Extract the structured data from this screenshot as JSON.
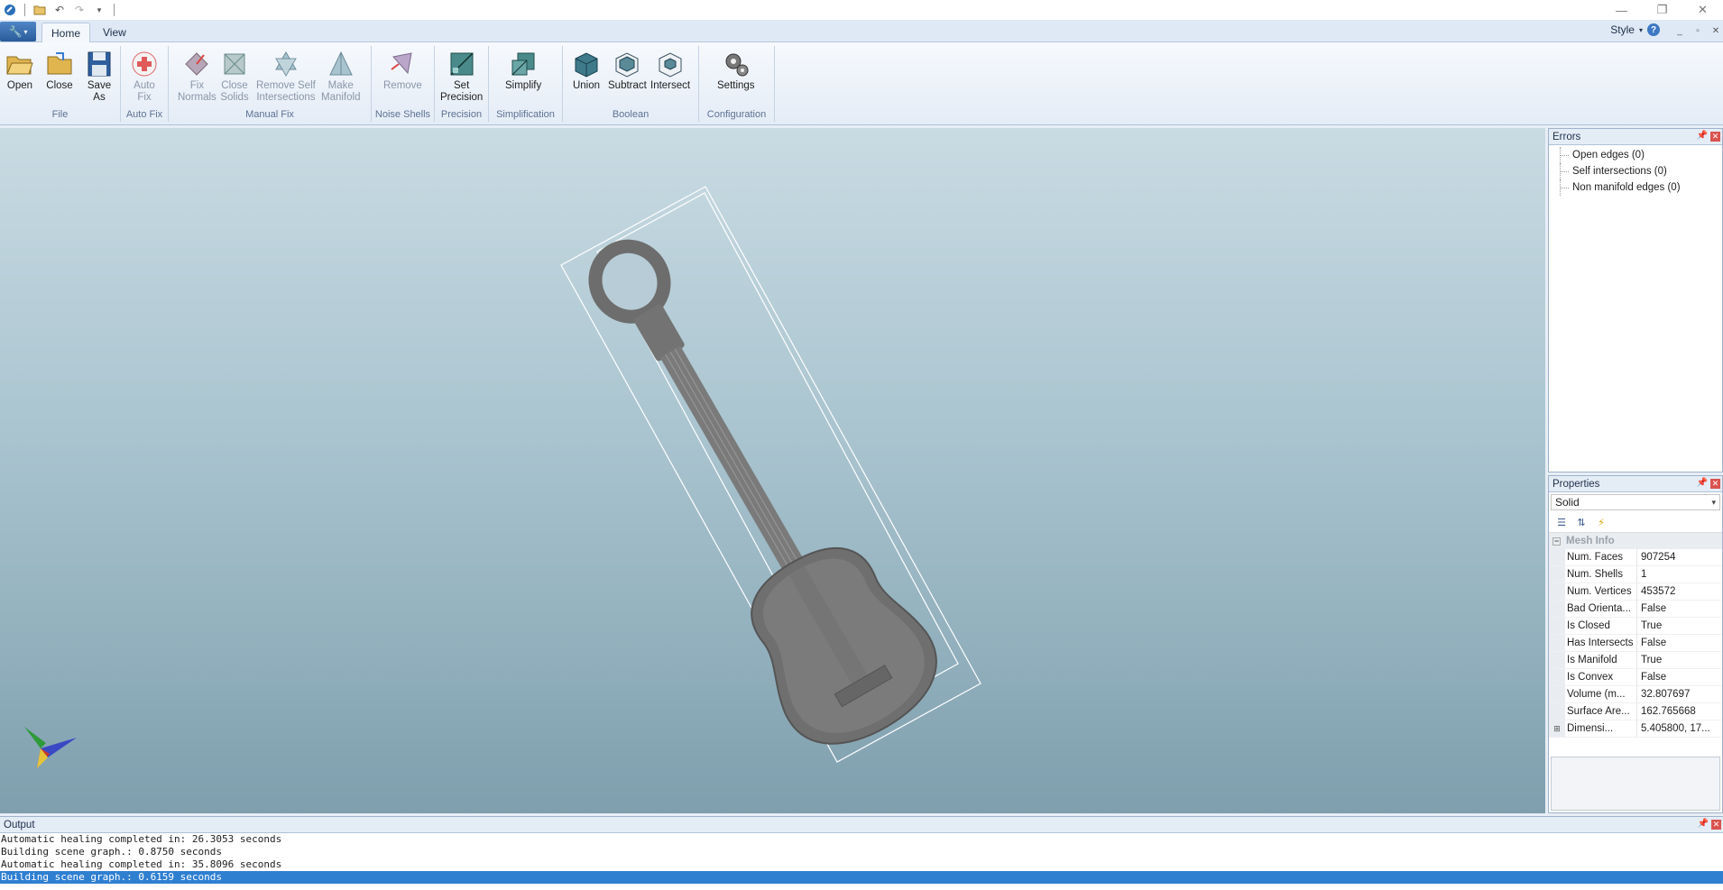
{
  "titlebar": {
    "quick_access": [
      "app-icon",
      "open-icon",
      "undo-icon",
      "redo-icon",
      "customize-icon"
    ],
    "controls": [
      "minimize",
      "restore",
      "close"
    ]
  },
  "tabs": [
    {
      "label": "Home",
      "active": true
    },
    {
      "label": "View",
      "active": false
    }
  ],
  "style_menu": {
    "label": "Style"
  },
  "ribbon": {
    "groups": [
      {
        "label": "File",
        "buttons": [
          "Open",
          "Close",
          "Save\nAs"
        ]
      },
      {
        "label": "Auto Fix",
        "buttons": [
          "Auto\nFix"
        ]
      },
      {
        "label": "Manual Fix",
        "buttons": [
          "Fix\nNormals",
          "Close\nSolids",
          "Remove Self\nIntersections",
          "Make\nManifold"
        ]
      },
      {
        "label": "Noise Shells",
        "buttons": [
          "Remove"
        ]
      },
      {
        "label": "Precision",
        "buttons": [
          "Set\nPrecision"
        ]
      },
      {
        "label": "Simplification",
        "buttons": [
          "Simplify"
        ]
      },
      {
        "label": "Boolean",
        "buttons": [
          "Union",
          "Subtract",
          "Intersect"
        ]
      },
      {
        "label": "Configuration",
        "buttons": [
          "Settings"
        ]
      }
    ],
    "labels": {
      "open": "Open",
      "close": "Close",
      "save1": "Save",
      "save2": "As",
      "autofix1": "Auto",
      "autofix2": "Fix",
      "fixnormals1": "Fix",
      "fixnormals2": "Normals",
      "closesolids1": "Close",
      "closesolids2": "Solids",
      "removeself1": "Remove Self",
      "removeself2": "Intersections",
      "manifold1": "Make",
      "manifold2": "Manifold",
      "remove": "Remove",
      "precision1": "Set",
      "precision2": "Precision",
      "simplify": "Simplify",
      "union": "Union",
      "subtract": "Subtract",
      "intersect": "Intersect",
      "settings": "Settings",
      "g_file": "File",
      "g_autofix": "Auto Fix",
      "g_manualfix": "Manual Fix",
      "g_noise": "Noise Shells",
      "g_precision": "Precision",
      "g_simplification": "Simplification",
      "g_boolean": "Boolean",
      "g_config": "Configuration"
    }
  },
  "viewport": {
    "model": "guitar-model",
    "background_top": "#c9dbe3",
    "background_bottom": "#7f9fae"
  },
  "errors_panel": {
    "title": "Errors",
    "items": [
      "Open edges (0)",
      "Self intersections (0)",
      "Non manifold edges (0)"
    ]
  },
  "properties_panel": {
    "title": "Properties",
    "selected": "Solid",
    "category": "Mesh Info",
    "rows": [
      {
        "name": "Num. Faces",
        "value": "907254"
      },
      {
        "name": "Num. Shells",
        "value": "1"
      },
      {
        "name": "Num. Vertices",
        "value": "453572"
      },
      {
        "name": "Bad Orienta...",
        "value": "False"
      },
      {
        "name": "Is Closed",
        "value": "True"
      },
      {
        "name": "Has Intersects",
        "value": "False"
      },
      {
        "name": "Is Manifold",
        "value": "True"
      },
      {
        "name": "Is Convex",
        "value": "False"
      },
      {
        "name": "Volume (m...",
        "value": "32.807697"
      },
      {
        "name": "Surface Are...",
        "value": "162.765668"
      },
      {
        "name": "Dimensi...",
        "value": "5.405800, 17..."
      }
    ]
  },
  "output_panel": {
    "title": "Output",
    "lines": [
      "Automatic healing completed in: 26.3053 seconds",
      "Building scene graph.: 0.8750 seconds",
      "Automatic healing completed in: 35.8096 seconds",
      "Building scene graph.: 0.6159 seconds"
    ],
    "selected_line": 3
  },
  "colors": {
    "ribbon_bg": "#e4ecf6",
    "accent": "#2f7fd1",
    "close_red": "#d9534f"
  }
}
